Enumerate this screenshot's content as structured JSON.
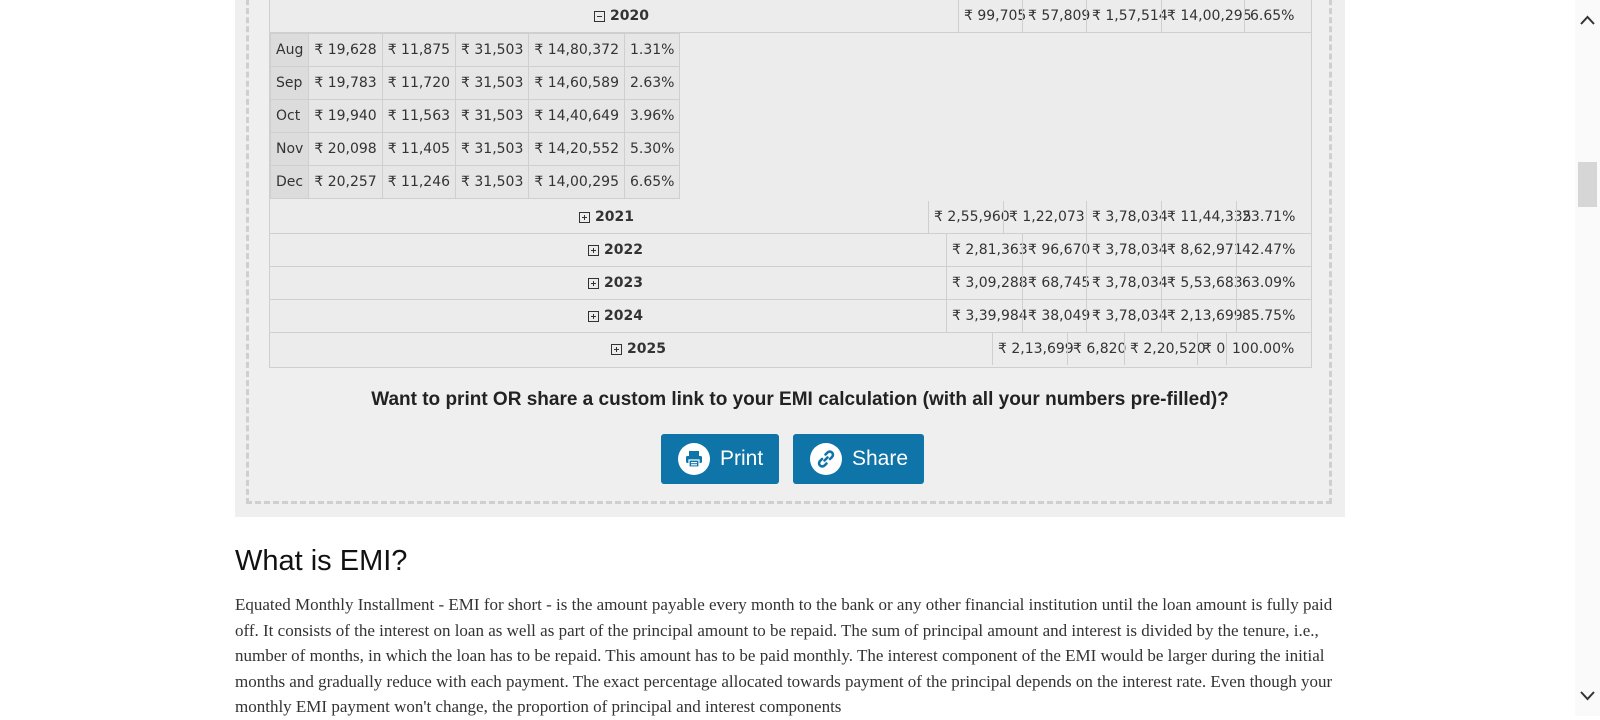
{
  "amortization": {
    "expanded_year": {
      "year": "2020",
      "principal": "₹ 99,705",
      "interest": "₹ 57,809",
      "total_payment": "₹ 1,57,514",
      "balance": "₹ 14,00,295",
      "loan_paid": "6.65%"
    },
    "months": [
      {
        "month": "Aug",
        "principal": "₹ 19,628",
        "interest": "₹ 11,875",
        "total_payment": "₹ 31,503",
        "balance": "₹ 14,80,372",
        "loan_paid": "1.31%"
      },
      {
        "month": "Sep",
        "principal": "₹ 19,783",
        "interest": "₹ 11,720",
        "total_payment": "₹ 31,503",
        "balance": "₹ 14,60,589",
        "loan_paid": "2.63%"
      },
      {
        "month": "Oct",
        "principal": "₹ 19,940",
        "interest": "₹ 11,563",
        "total_payment": "₹ 31,503",
        "balance": "₹ 14,40,649",
        "loan_paid": "3.96%"
      },
      {
        "month": "Nov",
        "principal": "₹ 20,098",
        "interest": "₹ 11,405",
        "total_payment": "₹ 31,503",
        "balance": "₹ 14,20,552",
        "loan_paid": "5.30%"
      },
      {
        "month": "Dec",
        "principal": "₹ 20,257",
        "interest": "₹ 11,246",
        "total_payment": "₹ 31,503",
        "balance": "₹ 14,00,295",
        "loan_paid": "6.65%"
      }
    ],
    "collapsed_years": [
      {
        "year": "2021",
        "principal": "₹ 2,55,960",
        "interest": "₹ 1,22,073",
        "total_payment": "₹ 3,78,034",
        "balance": "₹ 11,44,335",
        "loan_paid": "23.71%"
      },
      {
        "year": "2022",
        "principal": "₹ 2,81,363",
        "interest": "₹ 96,670",
        "total_payment": "₹ 3,78,034",
        "balance": "₹ 8,62,971",
        "loan_paid": "42.47%"
      },
      {
        "year": "2023",
        "principal": "₹ 3,09,288",
        "interest": "₹ 68,745",
        "total_payment": "₹ 3,78,034",
        "balance": "₹ 5,53,683",
        "loan_paid": "63.09%"
      },
      {
        "year": "2024",
        "principal": "₹ 3,39,984",
        "interest": "₹ 38,049",
        "total_payment": "₹ 3,78,034",
        "balance": "₹ 2,13,699",
        "loan_paid": "85.75%"
      },
      {
        "year": "2025",
        "principal": "₹ 2,13,699",
        "interest": "₹ 6,820",
        "total_payment": "₹ 2,20,520",
        "balance": "₹ 0",
        "loan_paid": "100.00%"
      }
    ]
  },
  "share_prompt": "Want to print OR share a custom link to your EMI calculation (with all your numbers pre-filled)?",
  "buttons": {
    "print": "Print",
    "share": "Share"
  },
  "section": {
    "heading": "What is EMI?",
    "paragraph": "Equated Monthly Installment - EMI for short - is the amount payable every month to the bank or any other financial institution until the loan amount is fully paid off. It consists of the interest on loan as well as part of the principal amount to be repaid. The sum of principal amount and interest is divided by the tenure, i.e., number of months, in which the loan has to be repaid. This amount has to be paid monthly. The interest component of the EMI would be larger during the initial months and gradually reduce with each payment. The exact percentage allocated towards payment of the principal depends on the interest rate. Even though your monthly EMI payment won't change, the proportion of principal and interest components"
  },
  "colors": {
    "button_bg": "#0f74a8",
    "panel_bg": "#efefef",
    "table_border": "#cfcfcf"
  },
  "icons": {
    "print": "print-icon",
    "share": "link-icon",
    "expand": "plus-square-icon",
    "collapse": "minus-square-icon"
  }
}
